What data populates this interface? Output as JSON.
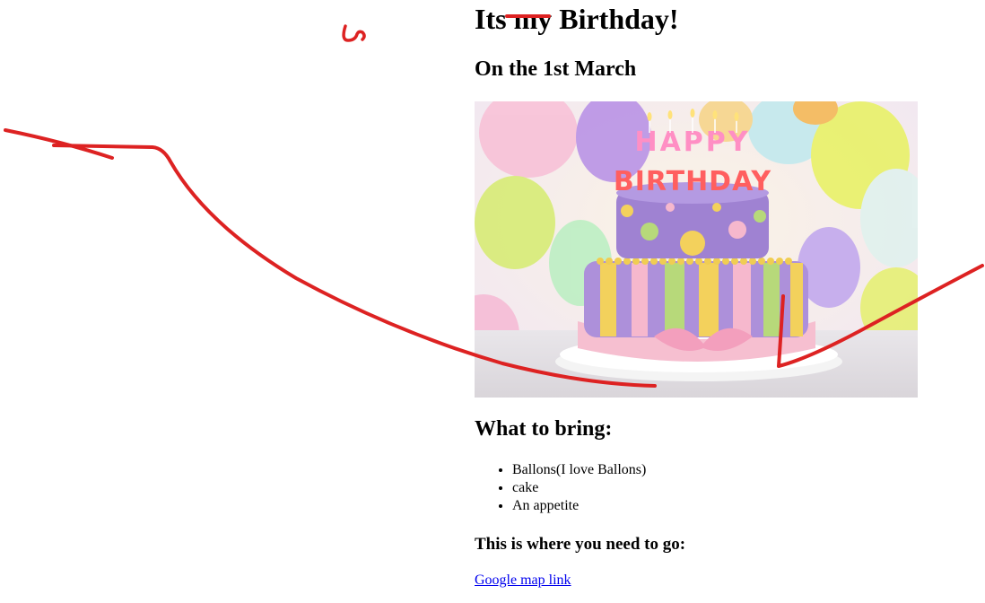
{
  "heading": {
    "title": "Its my Birthday!",
    "subtitle": "On the 1st March"
  },
  "bring": {
    "heading": "What to bring:",
    "items": [
      "Ballons(I love Ballons)",
      "cake",
      "An appetite"
    ]
  },
  "location": {
    "heading": "This is where you need to go:",
    "link_text": "Google map link"
  },
  "image": {
    "candle_letters_top": "HAPPY",
    "candle_letters_bottom": "BIRTHDAY"
  },
  "colors": {
    "link": "#0000ee",
    "annotation_ink": "#dd2222",
    "cake_purple": "#a98bd6",
    "cake_yellow": "#f2d25a",
    "cake_pink": "#f4b8cf",
    "cake_green": "#b8db7a"
  }
}
